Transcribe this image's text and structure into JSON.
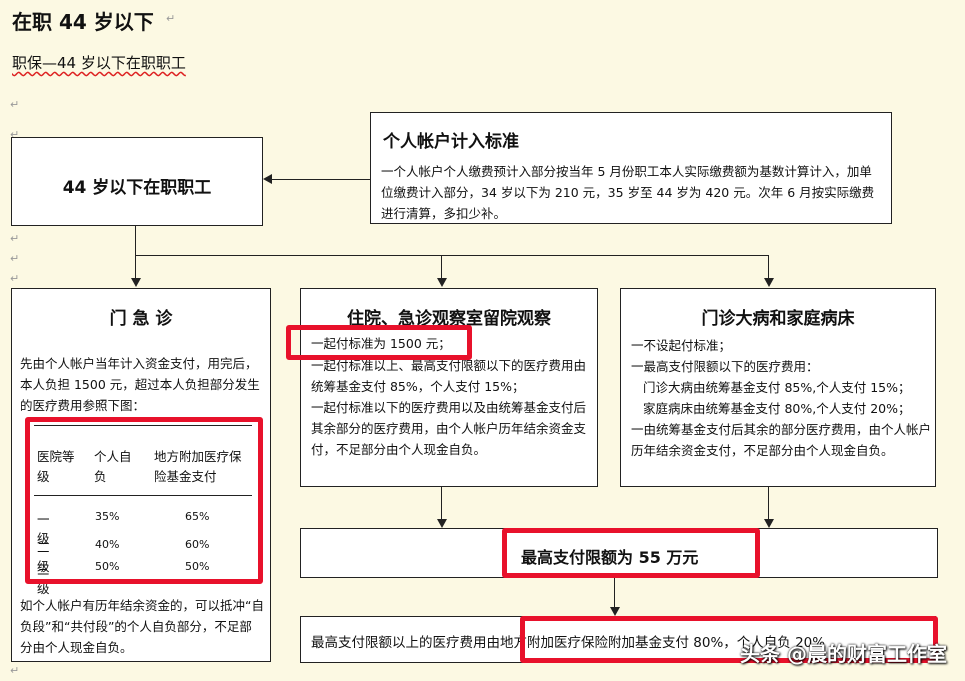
{
  "heading": "在职 44 岁以下",
  "subtitle": "职保—44 岁以下在职职工",
  "main_box": {
    "title": "44 岁以下在职职工"
  },
  "account_box": {
    "title": "个人帐户计入标准",
    "text": "一个人帐户个人缴费预计入部分按当年 5 月份职工本人实际缴费额为基数计算计入，加单位缴费计入部分，34 岁以下为 210 元，35 岁至 44 岁为 420 元。次年 6 月按实际缴费进行清算，多扣少补。"
  },
  "outpatient": {
    "title": "门  急  诊",
    "text1": "先由个人帐户当年计入资金支付，用完后，本人负担 1500 元，超过本人负担部分发生的医疗费用参照下图：",
    "table_headers": [
      "医院等级",
      "个人自负",
      "地方附加医疗保险基金支付"
    ],
    "table_rows": [
      [
        "一级",
        "35%",
        "65%"
      ],
      [
        "二级",
        "40%",
        "60%"
      ],
      [
        "三级",
        "50%",
        "50%"
      ]
    ],
    "text2": "如个人帐户有历年结余资金的，可以抵冲“自负段”和“共付段”的个人自负部分，不足部分由个人现金自负。"
  },
  "inpatient": {
    "title": "住院、急诊观察室留院观察",
    "line1": "一起付标准为 1500 元；",
    "line2": "一起付标准以上、最高支付限额以下的医疗费用由统筹基金支付 85%，个人支付 15%；",
    "line3": "一起付标准以下的医疗费用以及由统筹基金支付后其余部分的医疗费用，由个人帐户历年结余资金支付，不足部分由个人现金自负。"
  },
  "chronic": {
    "title": "门诊大病和家庭病床",
    "line1": "一不设起付标准；",
    "line2": "一最高支付限额以下的医疗费用：",
    "line3": "门诊大病由统筹基金支付 85%,个人支付 15%；",
    "line4": "家庭病床由统筹基金支付 80%,个人支付 20%；",
    "line5": "一由统筹基金支付后其余的部分医疗费用，由个人帐户历年结余资金支付，不足部分由个人现金自负。"
  },
  "limit_box": {
    "text": "最高支付限额为 55 万元"
  },
  "bottom_box": {
    "text": "最高支付限额以上的医疗费用由地方附加医疗保险附加基金支付 80%，个人自负 20%"
  },
  "watermark": "头条 @晨的财富工作室",
  "colors": {
    "background": "#fcf9e3",
    "highlight": "#e8112b"
  }
}
